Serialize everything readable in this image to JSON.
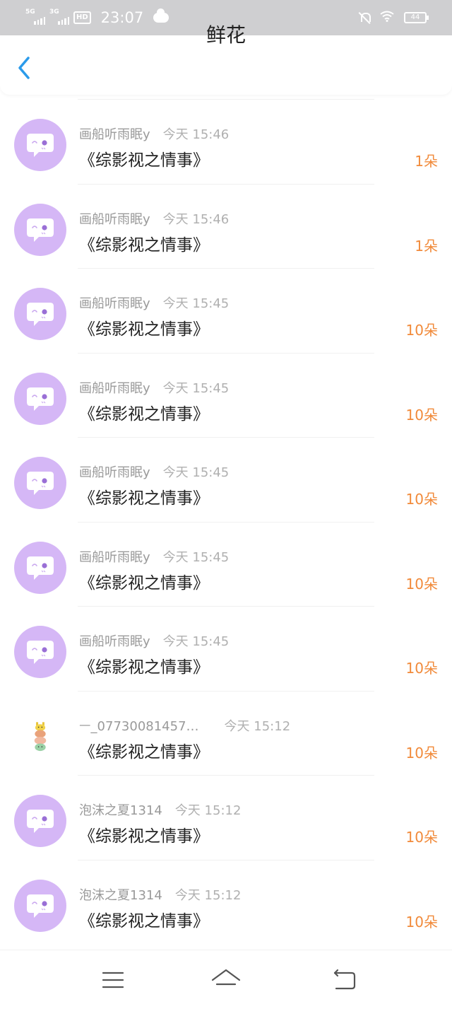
{
  "status_bar": {
    "sim1": "5G",
    "sim2": "3G",
    "hd": "HD",
    "time": "23:07",
    "battery": "44"
  },
  "header": {
    "title": "鲜花"
  },
  "colors": {
    "avatar_bg": "#d5b7f6",
    "count": "#f18a3a",
    "back_arrow": "#2b9bea"
  },
  "items": [
    {
      "user": "画船听雨眠y",
      "time": "今天 15:46",
      "book": "《综影视之情事》",
      "count": "1朵",
      "avatar": "default-chat-avatar"
    },
    {
      "user": "画船听雨眠y",
      "time": "今天 15:46",
      "book": "《综影视之情事》",
      "count": "1朵",
      "avatar": "default-chat-avatar"
    },
    {
      "user": "画船听雨眠y",
      "time": "今天 15:45",
      "book": "《综影视之情事》",
      "count": "10朵",
      "avatar": "default-chat-avatar"
    },
    {
      "user": "画船听雨眠y",
      "time": "今天 15:45",
      "book": "《综影视之情事》",
      "count": "10朵",
      "avatar": "default-chat-avatar"
    },
    {
      "user": "画船听雨眠y",
      "time": "今天 15:45",
      "book": "《综影视之情事》",
      "count": "10朵",
      "avatar": "default-chat-avatar"
    },
    {
      "user": "画船听雨眠y",
      "time": "今天 15:45",
      "book": "《综影视之情事》",
      "count": "10朵",
      "avatar": "default-chat-avatar"
    },
    {
      "user": "画船听雨眠y",
      "time": "今天 15:45",
      "book": "《综影视之情事》",
      "count": "10朵",
      "avatar": "default-chat-avatar"
    },
    {
      "user": "ㅡ_07730081457…",
      "time": "今天 15:12",
      "book": "《综影视之情事》",
      "count": "10朵",
      "avatar": "photo-avatar"
    },
    {
      "user": "泡沫之夏1314",
      "time": "今天 15:12",
      "book": "《综影视之情事》",
      "count": "10朵",
      "avatar": "default-chat-avatar"
    },
    {
      "user": "泡沫之夏1314",
      "time": "今天 15:12",
      "book": "《综影视之情事》",
      "count": "10朵",
      "avatar": "default-chat-avatar"
    }
  ],
  "bottom_nav": [
    "menu-icon",
    "home-icon",
    "back-icon"
  ]
}
